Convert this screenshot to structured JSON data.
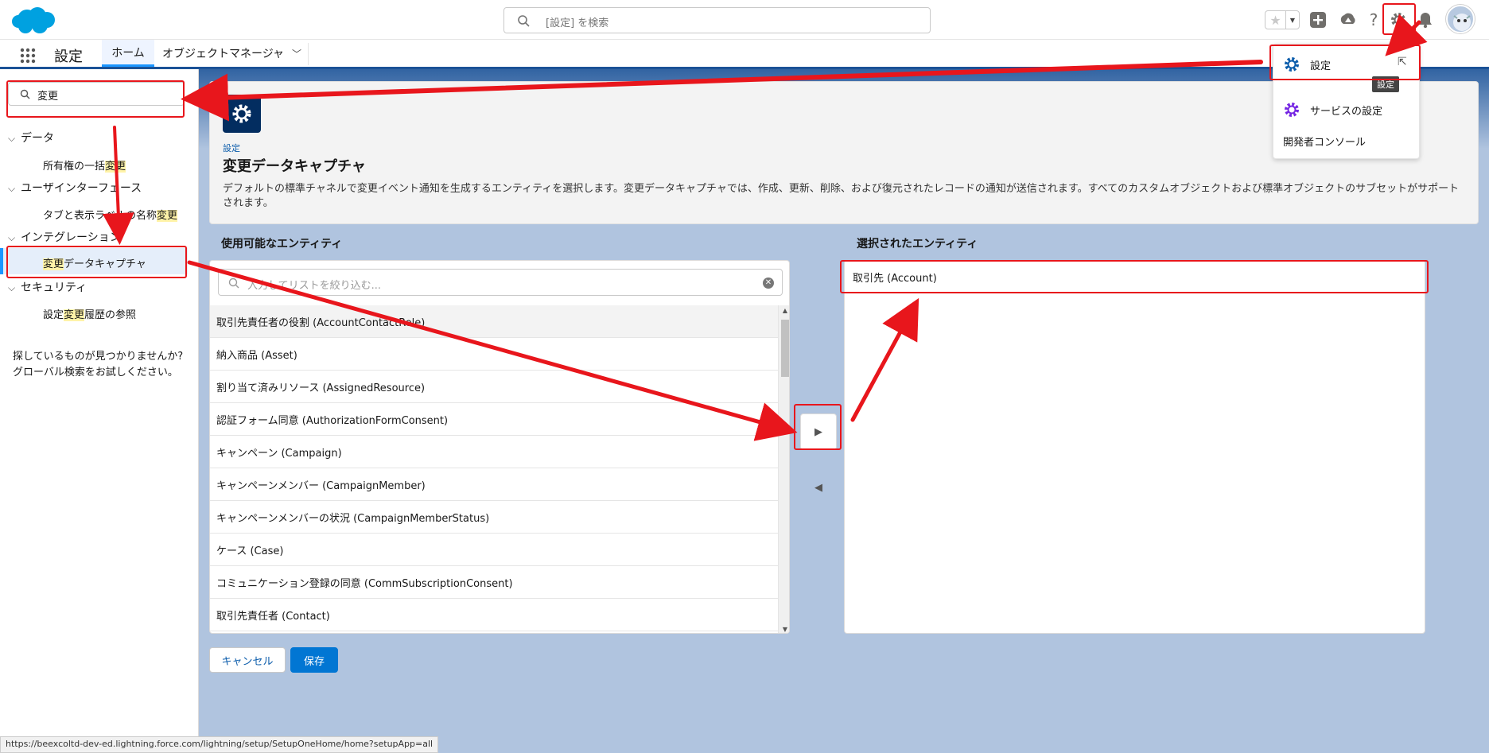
{
  "header": {
    "search_placeholder": "[設定] を検索"
  },
  "nav": {
    "app_title": "設定",
    "tabs": [
      {
        "label": "ホーム"
      },
      {
        "label": "オブジェクトマネージャ"
      }
    ]
  },
  "sidebar": {
    "quick_find_value": "変更",
    "sections": [
      {
        "label": "データ",
        "items": [
          {
            "before": "所有権の一括",
            "match": "変更",
            "after": ""
          }
        ]
      },
      {
        "label": "ユーザインターフェース",
        "items": [
          {
            "before": "タブと表示ラベルの名称",
            "match": "変更",
            "after": ""
          }
        ]
      },
      {
        "label": "インテグレーション",
        "items": [
          {
            "before": "",
            "match": "変更",
            "after": "データキャプチャ"
          }
        ]
      },
      {
        "label": "セキュリティ",
        "items": [
          {
            "before": "設定",
            "match": "変更",
            "after": "履歴の参照"
          }
        ]
      }
    ],
    "not_found_line1": "探しているものが見つかりませんか?",
    "not_found_line2": "グローバル検索をお試しください。"
  },
  "page": {
    "breadcrumb": "設定",
    "title": "変更データキャプチャ",
    "description": "デフォルトの標準チャネルで変更イベント通知を生成するエンティティを選択します。変更データキャプチャでは、作成、更新、削除、および復元されたレコードの通知が送信されます。すべてのカスタムオブジェクトおよび標準オブジェクトのサブセットがサポートされます。"
  },
  "available": {
    "label": "使用可能なエンティティ",
    "filter_placeholder": "入力してリストを絞り込む...",
    "items": [
      "取引先責任者の役割 (AccountContactRole)",
      "納入商品 (Asset)",
      "割り当て済みリソース (AssignedResource)",
      "認証フォーム同意 (AuthorizationFormConsent)",
      "キャンペーン (Campaign)",
      "キャンペーンメンバー (CampaignMember)",
      "キャンペーンメンバーの状況 (CampaignMemberStatus)",
      "ケース (Case)",
      "コミュニケーション登録の同意 (CommSubscriptionConsent)",
      "取引先責任者 (Contact)"
    ]
  },
  "selected": {
    "label": "選択されたエンティティ",
    "items": [
      "取引先 (Account)"
    ]
  },
  "buttons": {
    "cancel": "キャンセル",
    "save": "保存"
  },
  "setup_menu": {
    "items": [
      {
        "label": "設定",
        "icon": "gear-icon"
      },
      {
        "label": "サービスの設定",
        "icon": "gear-icon"
      },
      {
        "label": "開発者コンソール"
      }
    ],
    "tooltip": "設定"
  },
  "status_url": "https://beexcoltd-dev-ed.lightning.force.com/lightning/setup/SetupOneHome/home?setupApp=all",
  "colors": {
    "brand_blue": "#1b5297",
    "accent_blue": "#0176d3",
    "highlight_yellow": "#fff3a8",
    "annotation_red": "#e8161c",
    "service_purple": "#7526e3"
  }
}
